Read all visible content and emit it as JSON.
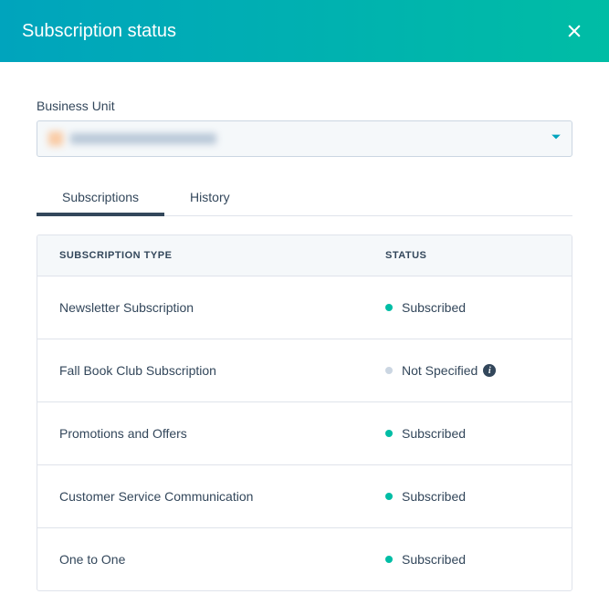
{
  "header": {
    "title": "Subscription status"
  },
  "businessUnit": {
    "label": "Business Unit"
  },
  "tabs": {
    "subscriptions": "Subscriptions",
    "history": "History"
  },
  "table": {
    "headers": {
      "type": "SUBSCRIPTION TYPE",
      "status": "STATUS"
    },
    "rows": [
      {
        "type": "Newsletter Subscription",
        "status": "Subscribed",
        "statusColor": "green",
        "info": false
      },
      {
        "type": "Fall Book Club Subscription",
        "status": "Not Specified",
        "statusColor": "gray",
        "info": true
      },
      {
        "type": "Promotions and Offers",
        "status": "Subscribed",
        "statusColor": "green",
        "info": false
      },
      {
        "type": "Customer Service Communication",
        "status": "Subscribed",
        "statusColor": "green",
        "info": false
      },
      {
        "type": "One to One",
        "status": "Subscribed",
        "statusColor": "green",
        "info": false
      }
    ]
  }
}
